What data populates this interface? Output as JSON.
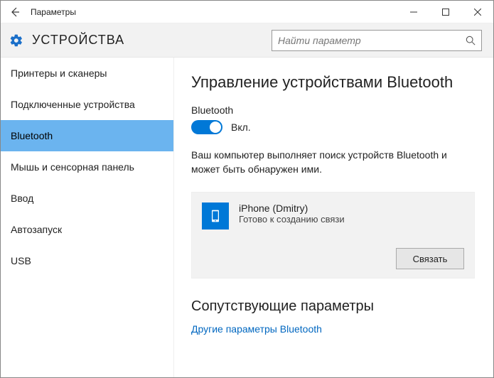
{
  "window": {
    "title": "Параметры"
  },
  "header": {
    "title": "УСТРОЙСТВА"
  },
  "search": {
    "placeholder": "Найти параметр"
  },
  "sidebar": {
    "items": [
      {
        "label": "Принтеры и сканеры"
      },
      {
        "label": "Подключенные устройства"
      },
      {
        "label": "Bluetooth"
      },
      {
        "label": "Мышь и сенсорная панель"
      },
      {
        "label": "Ввод"
      },
      {
        "label": "Автозапуск"
      },
      {
        "label": "USB"
      }
    ],
    "active_index": 2
  },
  "main": {
    "heading": "Управление устройствами Bluetooth",
    "toggle_label": "Bluetooth",
    "toggle_state_text": "Вкл.",
    "toggle_on": true,
    "info_text": "Ваш компьютер выполняет поиск устройств Bluetooth и может быть обнаружен ими.",
    "device": {
      "name": "iPhone (Dmitry)",
      "status": "Готово к созданию связи",
      "action_label": "Связать"
    },
    "related_heading": "Сопутствующие параметры",
    "related_link": "Другие параметры Bluetooth"
  }
}
